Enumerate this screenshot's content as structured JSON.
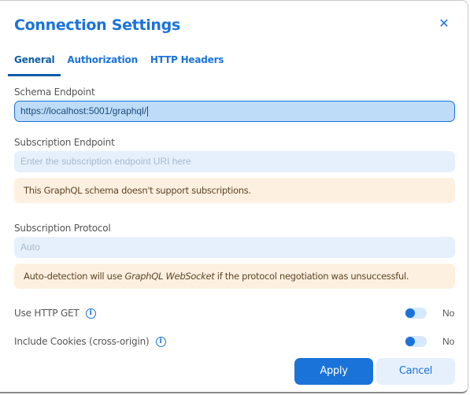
{
  "dialog": {
    "title": "Connection Settings",
    "close_icon": "close-icon"
  },
  "tabs": [
    {
      "label": "General",
      "active": true
    },
    {
      "label": "Authorization",
      "active": false
    },
    {
      "label": "HTTP Headers",
      "active": false
    }
  ],
  "schema_endpoint": {
    "label": "Schema Endpoint",
    "value": "https://localhost:5001/graphql/"
  },
  "subscription_endpoint": {
    "label": "Subscription Endpoint",
    "placeholder": "Enter the subscription endpoint URI here",
    "value": "",
    "notice": "This GraphQL schema doesn't support subscriptions."
  },
  "subscription_protocol": {
    "label": "Subscription Protocol",
    "value": "Auto",
    "notice_prefix": "Auto-detection will use ",
    "notice_emphasis": "GraphQL WebSocket",
    "notice_suffix": " if the protocol negotiation was unsuccessful."
  },
  "options": [
    {
      "label": "Use HTTP GET",
      "info_icon": "info-icon",
      "value": "No",
      "enabled": false
    },
    {
      "label": "Include Cookies (cross-origin)",
      "info_icon": "info-icon",
      "value": "No",
      "enabled": false
    }
  ],
  "footer": {
    "apply_label": "Apply",
    "cancel_label": "Cancel"
  },
  "colors": {
    "accent": "#1a73d9",
    "notice_bg": "#fef0e1",
    "input_bg": "#e6f0fc"
  }
}
